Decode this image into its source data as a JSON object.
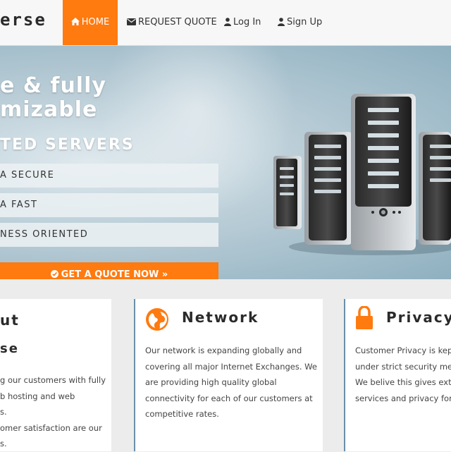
{
  "nav": {
    "logo": "erse",
    "items": [
      {
        "label": "HOME",
        "icon": "home-icon",
        "active": true
      },
      {
        "label": "REQUEST QUOTE",
        "icon": "envelope-icon"
      },
      {
        "label": "Log In",
        "icon": "user-icon"
      },
      {
        "label": "Sign Up",
        "icon": "user-icon"
      }
    ]
  },
  "hero": {
    "headline_line1": "e & fully",
    "headline_line2": "mizable",
    "subheadline": "TED SERVERS",
    "features": [
      "A SECURE",
      "A FAST",
      "NESS ORIENTED"
    ],
    "cta_label": "GET A QUOTE NOW »",
    "cta_icon": "check-circle-icon"
  },
  "cards": {
    "about": {
      "title": "ut",
      "subtitle": "se",
      "body": [
        "g our customers with fully",
        "b hosting and web",
        "s.",
        "omer satisfaction are our",
        "s."
      ]
    },
    "network": {
      "title": "Network",
      "icon": "globe-icon",
      "body": [
        "Our network is expanding globally and",
        "covering all major Internet Exchanges. We",
        "are providing high quality global",
        "connectivity for each of our customers at",
        "competitive rates."
      ]
    },
    "privacy": {
      "title": "Privacy",
      "icon": "lock-icon",
      "body": [
        "Customer Privacy is kept",
        "under strict security mea",
        "We belive this gives extra",
        "services and privacy for y"
      ]
    }
  },
  "colors": {
    "accent": "#ff7a0f",
    "card_border": "#6a8ea8",
    "page_bg": "#ececec"
  }
}
